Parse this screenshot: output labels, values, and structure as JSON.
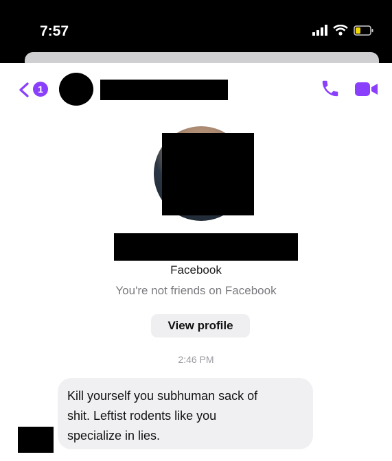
{
  "status_bar": {
    "time": "7:57",
    "icons": [
      "signal-icon",
      "wifi-icon",
      "battery-icon"
    ]
  },
  "header": {
    "back_icon": "chevron-left-icon",
    "unread_count": "1",
    "actions": [
      "phone-icon",
      "video-camera-icon"
    ]
  },
  "profile": {
    "platform": "Facebook",
    "relationship": "You're not friends on Facebook",
    "view_profile_label": "View profile"
  },
  "conversation": {
    "timestamp": "2:46 PM",
    "messages": [
      {
        "lines": [
          "Kill yourself you subhuman sack of",
          "shit.  Leftist rodents like you",
          "specialize in lies."
        ]
      }
    ]
  },
  "colors": {
    "accent": "#8a3ffc",
    "bubble": "#f0f0f3",
    "redaction": "#000000",
    "status_bar": "#000000"
  }
}
